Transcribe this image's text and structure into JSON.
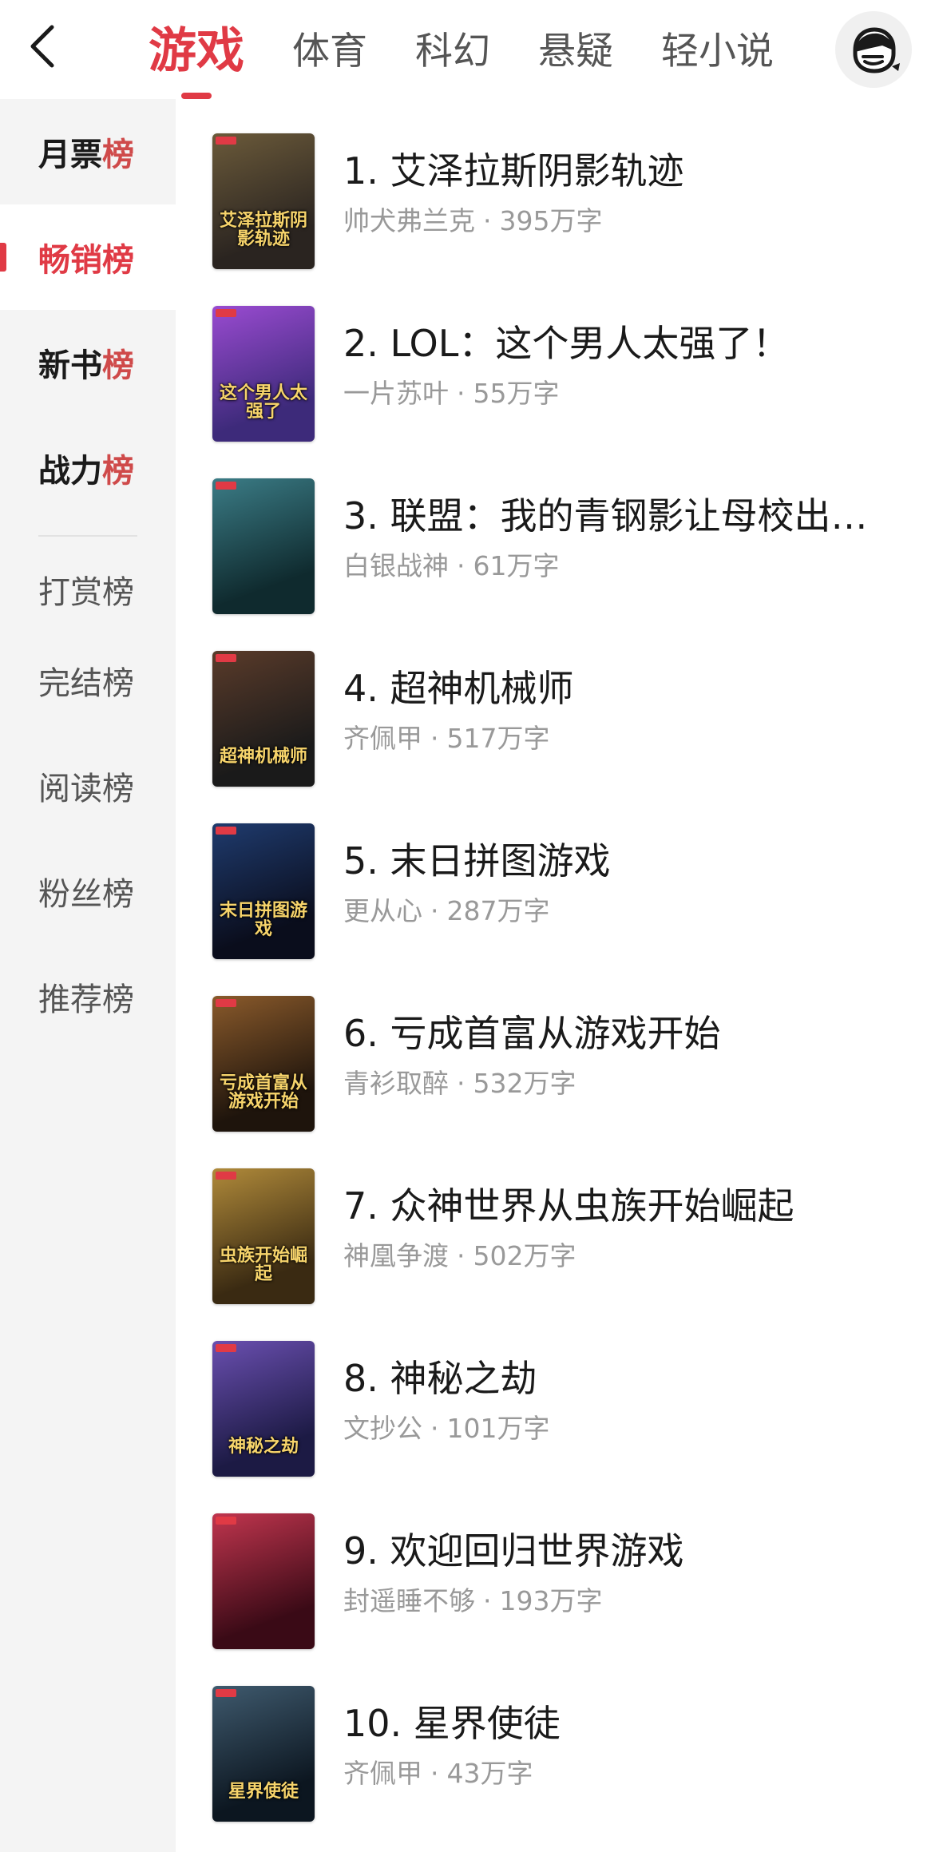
{
  "header": {
    "tabs": [
      {
        "label": "游戏",
        "active": true
      },
      {
        "label": "体育",
        "active": false
      },
      {
        "label": "科幻",
        "active": false
      },
      {
        "label": "悬疑",
        "active": false
      },
      {
        "label": "轻小说",
        "active": false
      }
    ],
    "accent_color": "#e03a45"
  },
  "sidebar": {
    "primary": [
      {
        "main": "月票",
        "accent": "榜",
        "active": false
      },
      {
        "main": "畅销",
        "accent": "榜",
        "active": true
      },
      {
        "main": "新书",
        "accent": "榜",
        "active": false
      },
      {
        "main": "战力",
        "accent": "榜",
        "active": false
      }
    ],
    "secondary": [
      "打赏榜",
      "完结榜",
      "阅读榜",
      "粉丝榜",
      "推荐榜"
    ]
  },
  "books": [
    {
      "title": "1. 艾泽拉斯阴影轨迹",
      "author": "帅犬弗兰克",
      "words": "395万字",
      "cover_text": "艾泽拉斯阴影轨迹",
      "cover_colors": [
        "#2a2420",
        "#6b5a3a"
      ]
    },
    {
      "title": "2. LOL：这个男人太强了！",
      "author": "一片苏叶",
      "words": "55万字",
      "cover_text": "这个男人太强了",
      "cover_colors": [
        "#3d2a7a",
        "#9a4bd1"
      ]
    },
    {
      "title": "3. 联盟：我的青钢影让母校出…",
      "author": "白银战神",
      "words": "61万字",
      "cover_text": "",
      "cover_colors": [
        "#0f2a2e",
        "#3b7c86"
      ]
    },
    {
      "title": "4. 超神机械师",
      "author": "齐佩甲",
      "words": "517万字",
      "cover_text": "超神机械师",
      "cover_colors": [
        "#1a1a1a",
        "#5a3b2a"
      ]
    },
    {
      "title": "5. 末日拼图游戏",
      "author": "更从心",
      "words": "287万字",
      "cover_text": "末日拼图游戏",
      "cover_colors": [
        "#0a0d1c",
        "#1f3b6e"
      ]
    },
    {
      "title": "6. 亏成首富从游戏开始",
      "author": "青衫取醉",
      "words": "532万字",
      "cover_text": "亏成首富从游戏开始",
      "cover_colors": [
        "#1e140c",
        "#8a5a2b"
      ]
    },
    {
      "title": "7. 众神世界从虫族开始崛起",
      "author": "神凰争渡",
      "words": "502万字",
      "cover_text": "虫族开始崛起",
      "cover_colors": [
        "#3a2a12",
        "#b08a3a"
      ]
    },
    {
      "title": "8. 神秘之劫",
      "author": "文抄公",
      "words": "101万字",
      "cover_text": "神秘之劫",
      "cover_colors": [
        "#1c1a44",
        "#6a4fb0"
      ]
    },
    {
      "title": "9. 欢迎回归世界游戏",
      "author": "封遥睡不够",
      "words": "193万字",
      "cover_text": "",
      "cover_colors": [
        "#3a0a16",
        "#c0354e"
      ]
    },
    {
      "title": "10. 星界使徒",
      "author": "齐佩甲",
      "words": "43万字",
      "cover_text": "星界使徒",
      "cover_colors": [
        "#0c1620",
        "#3f5a6e"
      ]
    }
  ]
}
